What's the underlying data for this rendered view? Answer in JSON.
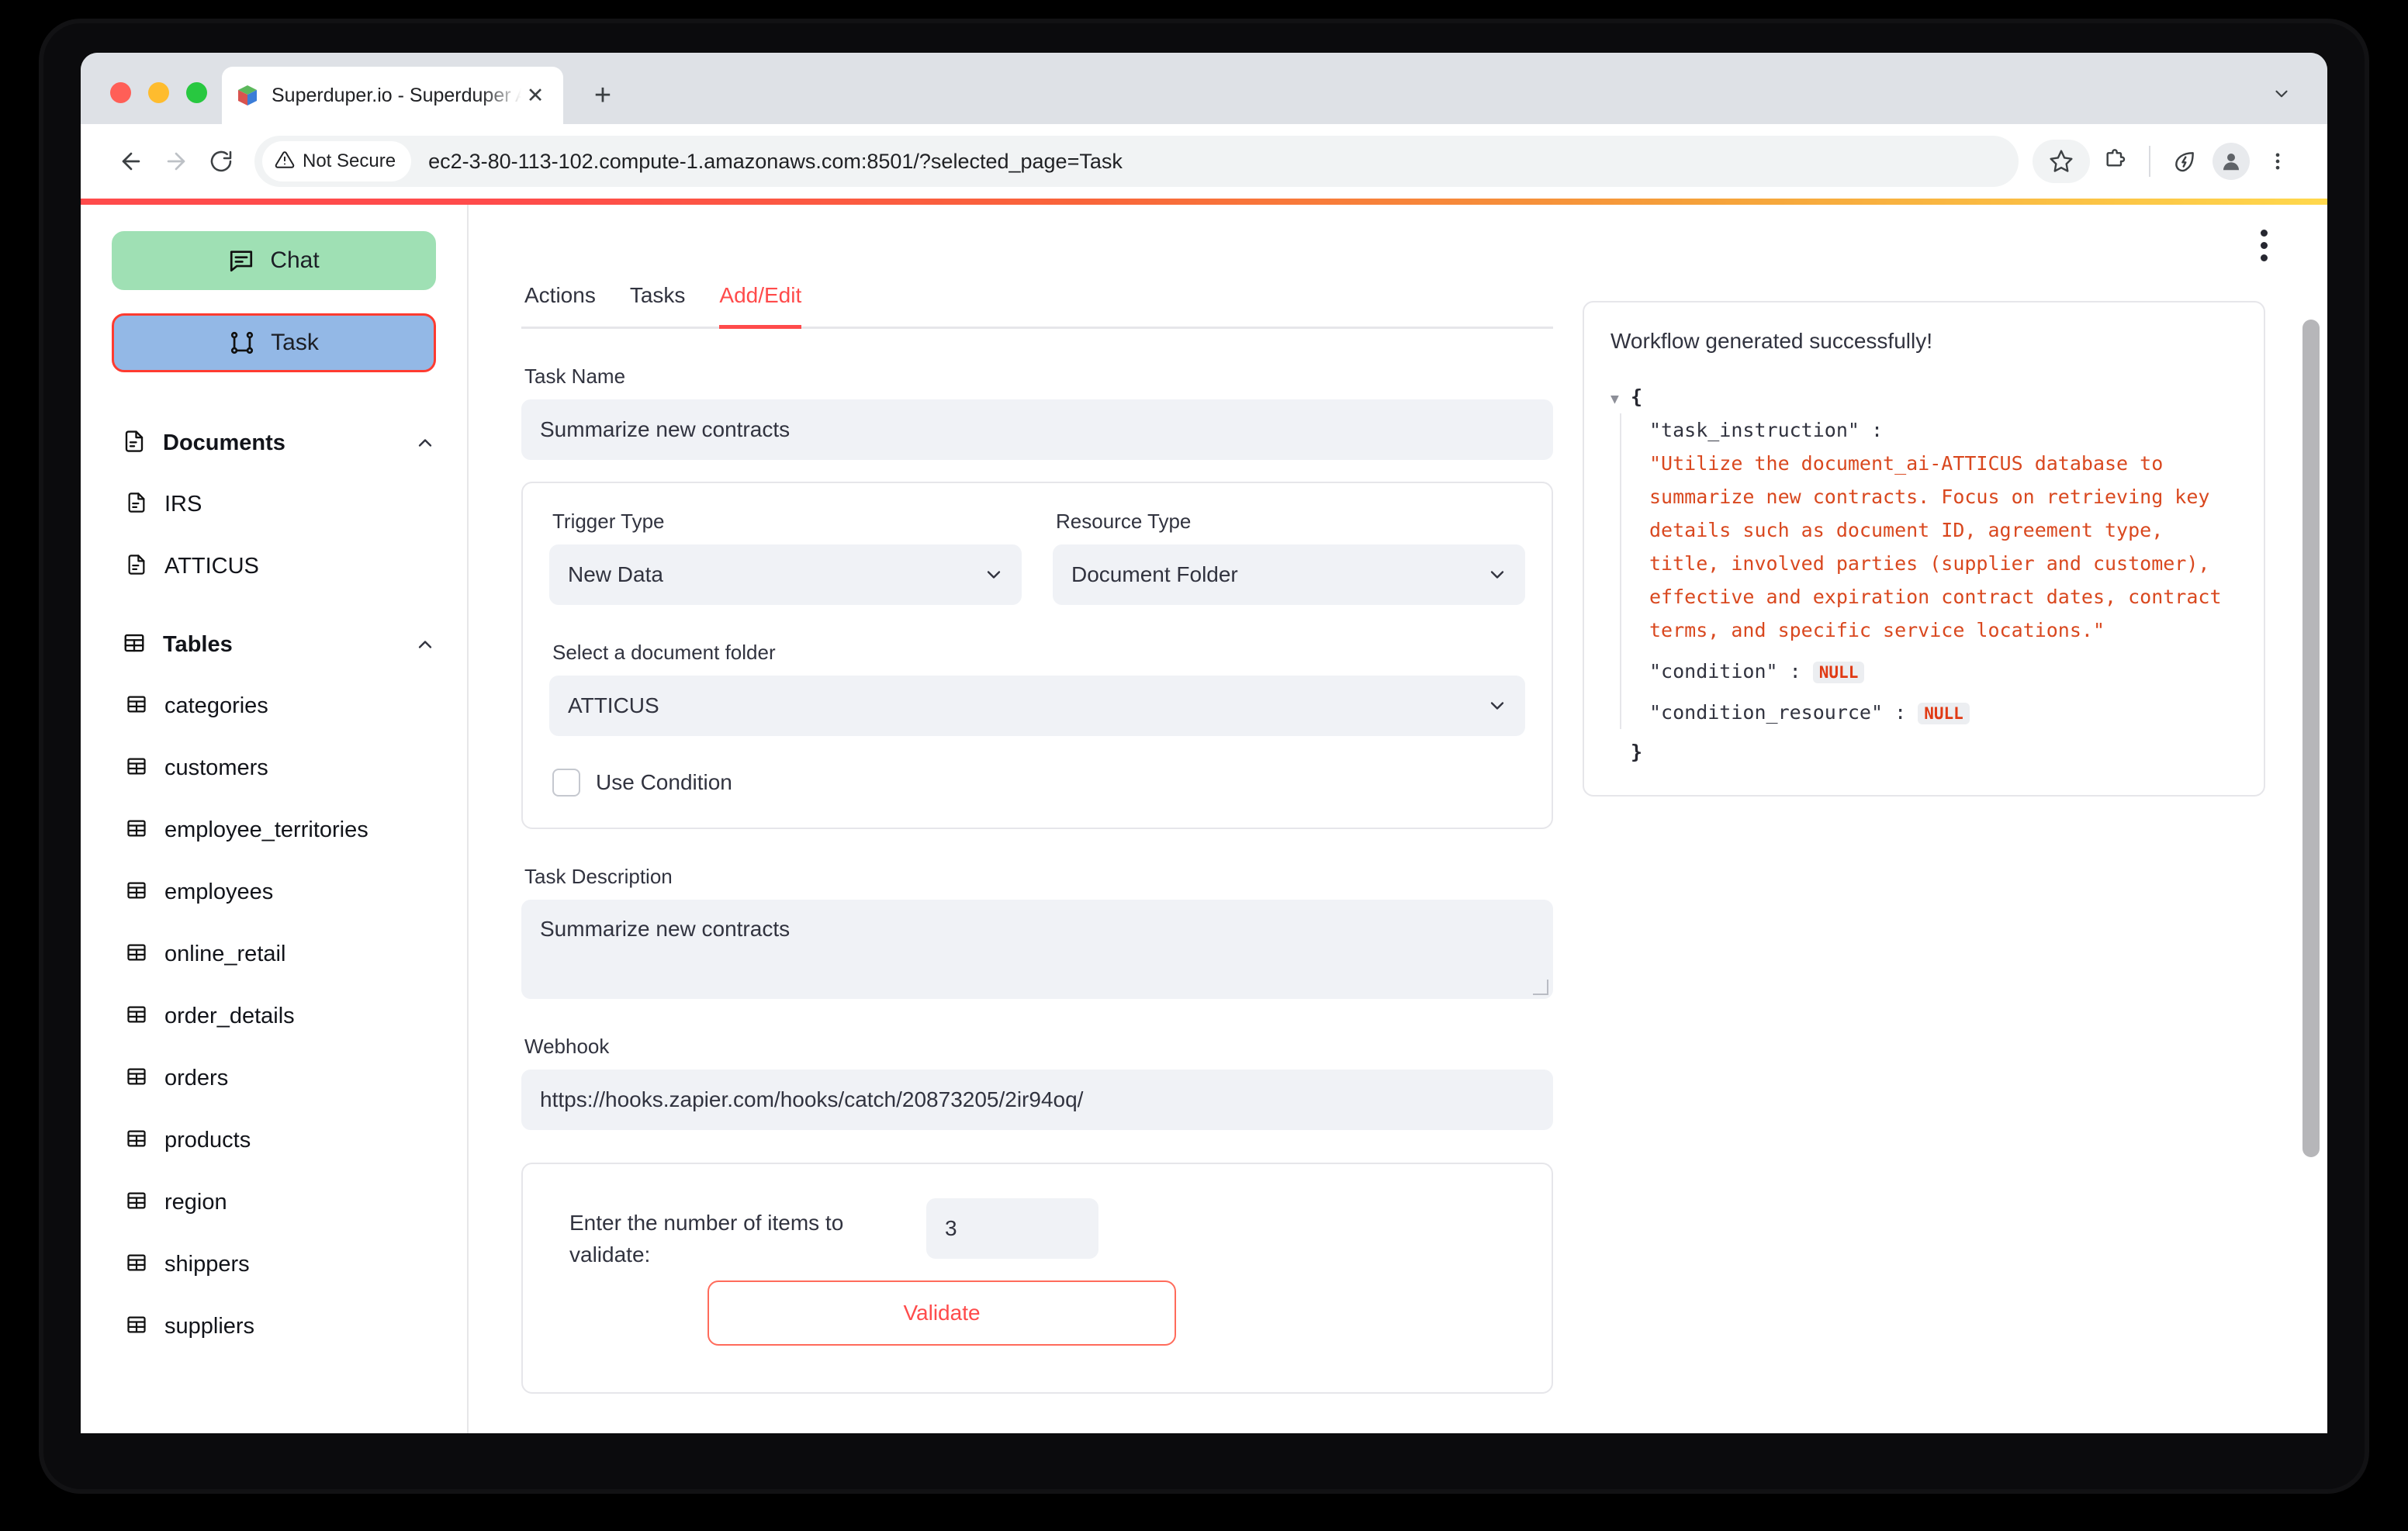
{
  "browser": {
    "tab_title": "Superduper.io - Superduper A",
    "favicon_icon": "cube-logo-icon",
    "tab_close_icon": "close-icon",
    "new_tab_icon": "plus-icon",
    "tab_list_icon": "chevron-down-icon",
    "back_icon": "arrow-left-icon",
    "forward_icon": "arrow-right-icon",
    "reload_icon": "reload-icon",
    "security_icon": "warning-triangle-icon",
    "security_label": "Not Secure",
    "url": "ec2-3-80-113-102.compute-1.amazonaws.com:8501/?selected_page=Task",
    "bookmark_icon": "star-icon",
    "extensions_icon": "puzzle-piece-icon",
    "performance_icon": "leaf-icon",
    "profile_icon": "person-avatar-icon",
    "menu_icon": "three-dots-vertical-icon"
  },
  "sidebar": {
    "buttons": [
      {
        "label": "Chat",
        "icon": "chat-bubble-icon",
        "color": "#9fe0b4"
      },
      {
        "label": "Task",
        "icon": "task-flow-icon",
        "color": "#93b8e6",
        "selected_outline": "#ff3b30"
      }
    ],
    "groups": [
      {
        "label": "Documents",
        "icon": "document-icon",
        "chevron": "chevron-up-icon",
        "items": [
          {
            "label": "IRS",
            "icon": "document-icon"
          },
          {
            "label": "ATTICUS",
            "icon": "document-icon"
          }
        ]
      },
      {
        "label": "Tables",
        "icon": "table-icon",
        "chevron": "chevron-up-icon",
        "items": [
          {
            "label": "categories",
            "icon": "table-icon"
          },
          {
            "label": "customers",
            "icon": "table-icon"
          },
          {
            "label": "employee_territories",
            "icon": "table-icon"
          },
          {
            "label": "employees",
            "icon": "table-icon"
          },
          {
            "label": "online_retail",
            "icon": "table-icon"
          },
          {
            "label": "order_details",
            "icon": "table-icon"
          },
          {
            "label": "orders",
            "icon": "table-icon"
          },
          {
            "label": "products",
            "icon": "table-icon"
          },
          {
            "label": "region",
            "icon": "table-icon"
          },
          {
            "label": "shippers",
            "icon": "table-icon"
          },
          {
            "label": "suppliers",
            "icon": "table-icon"
          }
        ]
      }
    ]
  },
  "main": {
    "overflow_menu_icon": "three-dots-vertical-icon",
    "tabs": [
      {
        "label": "Actions",
        "active": false
      },
      {
        "label": "Tasks",
        "active": false
      },
      {
        "label": "Add/Edit",
        "active": true
      }
    ],
    "accent_color": "#ff4b4b",
    "form": {
      "task_name_label": "Task Name",
      "task_name_value": "Summarize new contracts",
      "trigger_type_label": "Trigger Type",
      "trigger_type_value": "New Data",
      "resource_type_label": "Resource Type",
      "resource_type_value": "Document Folder",
      "document_folder_label": "Select a document folder",
      "document_folder_value": "ATTICUS",
      "use_condition_label": "Use Condition",
      "use_condition_checked": false,
      "task_description_label": "Task Description",
      "task_description_value": "Summarize new contracts",
      "webhook_label": "Webhook",
      "webhook_value": "https://hooks.zapier.com/hooks/catch/20873205/2ir94oq/",
      "validate_prompt": "Enter the number of items to validate:",
      "validate_count": "3",
      "validate_button": "Validate"
    }
  },
  "json_panel": {
    "title": "Workflow generated successfully!",
    "collapse_icon": "triangle-down-icon",
    "open_brace": "{",
    "close_brace": "}",
    "entries": [
      {
        "key": "\"task_instruction\"",
        "colon": ":",
        "value": "\"Utilize the document_ai-ATTICUS database to summarize new contracts. Focus on retrieving key details such as document ID, agreement type, title, involved parties (supplier and customer), effective and expiration contract dates, contract terms, and specific service locations.\"",
        "type": "string"
      },
      {
        "key": "\"condition\"",
        "colon": ":",
        "value": "NULL",
        "type": "null"
      },
      {
        "key": "\"condition_resource\"",
        "colon": ":",
        "value": "NULL",
        "type": "null"
      }
    ]
  }
}
